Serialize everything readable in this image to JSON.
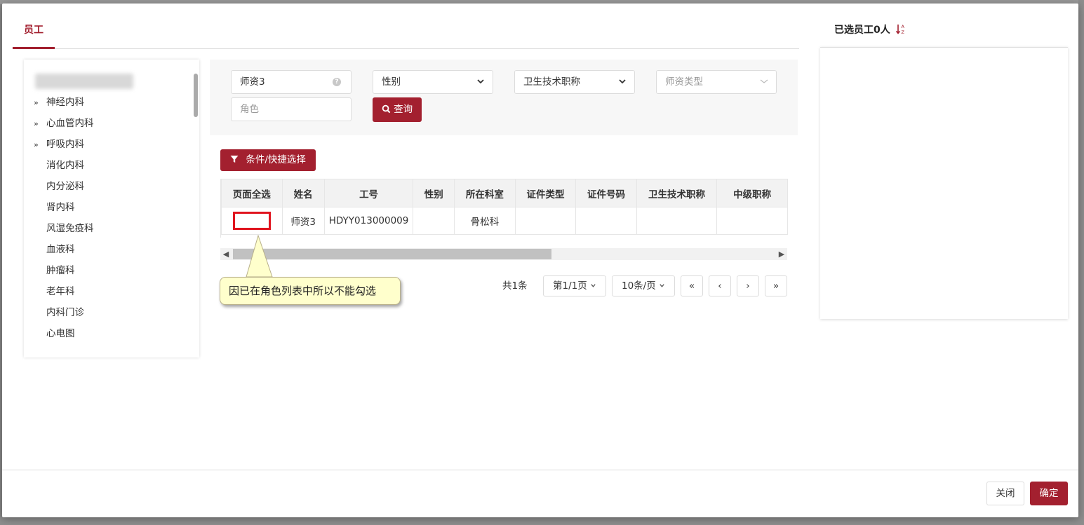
{
  "tabs": [
    {
      "label": "员工"
    }
  ],
  "tree": {
    "items": [
      {
        "label": "神经内科",
        "expandable": true
      },
      {
        "label": "心血管内科",
        "expandable": true
      },
      {
        "label": "呼吸内科",
        "expandable": true
      },
      {
        "label": "消化内科",
        "expandable": false
      },
      {
        "label": "内分泌科",
        "expandable": false
      },
      {
        "label": "肾内科",
        "expandable": false
      },
      {
        "label": "风湿免疫科",
        "expandable": false
      },
      {
        "label": "血液科",
        "expandable": false
      },
      {
        "label": "肿瘤科",
        "expandable": false
      },
      {
        "label": "老年科",
        "expandable": false
      },
      {
        "label": "内科门诊",
        "expandable": false
      },
      {
        "label": "心电图",
        "expandable": false
      }
    ],
    "expand_glyph": "»"
  },
  "search": {
    "name_value": "师资3",
    "gender_label": "性别",
    "title_label": "卫生技术职称",
    "teacher_type_placeholder": "师资类型",
    "role_placeholder": "角色",
    "query_label": "查询"
  },
  "toolbar": {
    "condition_label": "条件/快捷选择"
  },
  "table": {
    "headers": [
      "页面全选",
      "姓名",
      "工号",
      "性别",
      "所在科室",
      "证件类型",
      "证件号码",
      "卫生技术职称",
      "中级职称"
    ],
    "rows": [
      {
        "name": "师资3",
        "id": "HDYY013000009",
        "gender": "",
        "dept": "骨松科",
        "id_type": "",
        "id_number": "",
        "tech_title": "",
        "mid_title": ""
      }
    ]
  },
  "callout": {
    "text": "因已在角色列表中所以不能勾选"
  },
  "pager": {
    "total": "共1条",
    "page": "第1/1页",
    "size": "10条/页",
    "first": "«",
    "prev": "‹",
    "next": "›",
    "last": "»"
  },
  "selected": {
    "title": "已选员工0人"
  },
  "footer": {
    "close_label": "关闭",
    "ok_label": "确定"
  },
  "colors": {
    "accent": "#a3202f",
    "highlight_border": "#e0141e",
    "callout_bg": "#ffffcc"
  }
}
